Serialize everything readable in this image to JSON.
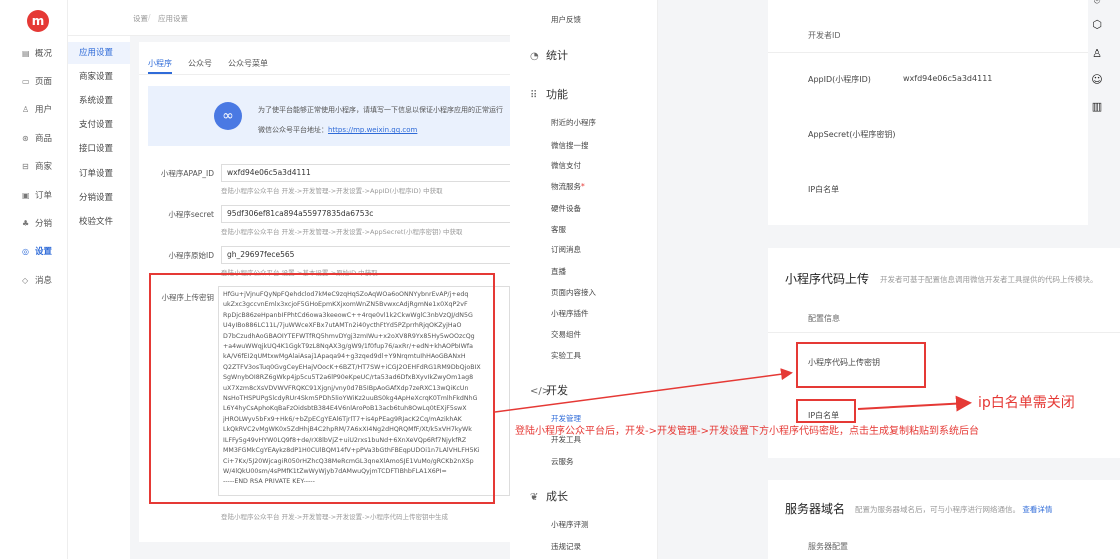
{
  "app": {
    "logo": "m"
  },
  "rail": [
    {
      "icon": "▤",
      "label": "概况"
    },
    {
      "icon": "▭",
      "label": "页面"
    },
    {
      "icon": "♙",
      "label": "用户"
    },
    {
      "icon": "⊛",
      "label": "商品"
    },
    {
      "icon": "⊟",
      "label": "商家"
    },
    {
      "icon": "▣",
      "label": "订单"
    },
    {
      "icon": "♣",
      "label": "分销"
    },
    {
      "icon": "◎",
      "label": "设置"
    },
    {
      "icon": "◇",
      "label": "消息"
    }
  ],
  "header": {
    "section": "设置",
    "breadcrumb_root": "设置",
    "breadcrumb_sep": "/",
    "breadcrumb_current": "应用设置"
  },
  "submenu": [
    "应用设置",
    "商家设置",
    "系统设置",
    "支付设置",
    "接口设置",
    "订单设置",
    "分销设置",
    "校验文件"
  ],
  "tabs": [
    "小程序",
    "公众号",
    "公众号菜单"
  ],
  "banner": {
    "text": "为了使平台能够正常使用小程序，请填写一下信息以保证小程序应用的正常运行",
    "link_prefix": "微信公众号平台地址：",
    "link": "https://mp.weixin.qq.com"
  },
  "form": {
    "appid_label": "小程序APAP_ID",
    "appid_value": "wxfd94e06c5a3d4111",
    "appid_hint": "登陆小程序公众平台 开发->开发管理->开发设置->AppID(小程序ID) 中获取",
    "secret_label": "小程序secret",
    "secret_value": "95df306ef81ca894a55977835da6753c",
    "secret_hint": "登陆小程序公众平台 开发->开发管理->开发设置->AppSecret(小程序密钥) 中获取",
    "origin_label": "小程序原始ID",
    "origin_value": "gh_29697fece565",
    "origin_hint": "登陆小程序公众平台 设置->基本设置->原始ID 中获取",
    "key_label": "小程序上传密钥",
    "key_lines": [
      "HfGu+jVjnuFQyNpFQehdclod7kMeC9zqHqSZoAqWOa6oONNYybnrEvAP/j+edq",
      "ukZxc3gccvnEmlx3xcjoF5GHoEpmKXjxomWnZN5BvwxcAdjRgmNe1x0XqP2vF",
      "RpDjcB86zeHpanbIFPhtCd6owa3keeowC++4rqe0vl1k2CkwWglC3nbVzQJ/dN5G",
      "U4yIBo886LC11L/7juWWceXFBx7utAMTn2i40ycthFtYd5PZprrhRjqOKZyjHaO",
      "D7bCzudhAoGBAOIYTEFWTfRQ5hmvDYgj3zmIWu+x2oXV8R9Yx85Hy5wOOzcQg",
      "+a4wuWWqjkUQ4K1GgkT9zL8NqAX3g/gW9/1f0fup76/axRr/+edN+khAOPbIWfa",
      "kA/V6fEI2qUMtxwMgAlaiAsaj1Apaqa94+g3zqed9dl+Y9NrqmtuIhHAoGBANxH",
      "Q2ZTFV3osTuq0GvgCeyEHajVOocK+6BZT/HT7SW+iCGJ2OEHFdRG1RM9DbQjoBIX",
      "SgWnybOI8RZ6gWkp4jp5cu5T2a6lP90eKpeUC/rta53ad6DfxBXyvIkZwyOm1ag8",
      "uX7Xzm8cXsVDVWVFRQKC91Xjgnj/vny0d7B5IBpAoGAfXdp7zeRXC13wQiKcUn",
      "NsHoTHSPUPgSlcdyRUr4Skm5PDh5lioYWiKz2uuBS0kg4ApHeXcrqK0TmlhFkdNhG",
      "L6Y4hyCsAphoKqBaFzOidsbtB384E4V6nlAroPoB13acb6tuh8OwLq0tEXjF5swX",
      "jHROLWyv5bFx9+Hk6/+bZpECgYEAl6TjrlT7+is4pPEag9RJacK2Cq/mAzikhAK",
      "LkQkRVC2vMgWK0x5ZdHhjB4C2hpRM/7A6xXI4Ng2dHQRQMfF/Xt/k5xVH7kyWk",
      "ILFFy5g49vHYW0LQ9f8+de/rX8lbVjZ+uiU2rxs1buNd+6XnXeVQp6Rf7NjykfRZ",
      "MM3FGMkCgYEAykz8dP1H0CUlBQM14fV+pPVa3bGthFBEqpUDOi1n7LAlVHLFH5Ki",
      "Ci+7Kx/5J20WjcagiR050rHZhcQ38MeRcmGL3qneXlAmoSJE1VuMo/gRCKb2nXSp",
      "W/4lQkU00sm/4sPMfK1tZwWyWjyb7dAMwuQyjmTCDFTIBhbFLA1X6PI=",
      "-----END RSA PRIVATE KEY-----"
    ],
    "key_hint": "登陆小程序公众平台 开发->开发管理->开发设置->小程序代码上传密钥中生成"
  },
  "mid_menu": {
    "top_item": "用户反馈",
    "stats": "统计",
    "features": "功能",
    "feature_items": [
      "附近的小程序",
      "微信搜一搜",
      "微信支付",
      "物流服务",
      "硬件设备",
      "客服",
      "订阅消息",
      "直播",
      "页面内容接入",
      "小程序插件",
      "交易组件",
      "实验工具"
    ],
    "feature_new_dot": "*",
    "develop": "开发",
    "develop_items": [
      "开发管理",
      "开发工具",
      "云服务"
    ],
    "growth": "成长",
    "growth_items": [
      "小程序评测",
      "违规记录"
    ]
  },
  "right": {
    "dev_id_title": "开发者ID",
    "appid_label": "AppID(小程序ID)",
    "appid_value": "wxfd94e06c5a3d4111",
    "secret_label": "AppSecret(小程序密钥)",
    "ip_label": "IP白名单",
    "upload_title": "小程序代码上传",
    "upload_desc": "开发者可基于配置信息调用微信开发者工具提供的代码上传模块。",
    "config_label": "配置信息",
    "upload_key_label": "小程序代码上传密钥",
    "upload_ip_label": "IP白名单",
    "server_title": "服务器域名",
    "server_desc": "配置为服务器域名后，可与小程序进行网络通信。",
    "server_link": "查看详情",
    "server_config_label": "服务器配置"
  },
  "annotations": {
    "ip_note": "ip白名单需关闭",
    "instruction": "登陆小程序公众平台后，开发->开发管理->开发设置下方小程序代码密匙，点击生成复制粘贴到系统后台",
    "color": "#e53935"
  },
  "toolbar_icons": [
    "⌾",
    "⬡",
    "♙",
    "☺",
    "▥"
  ]
}
